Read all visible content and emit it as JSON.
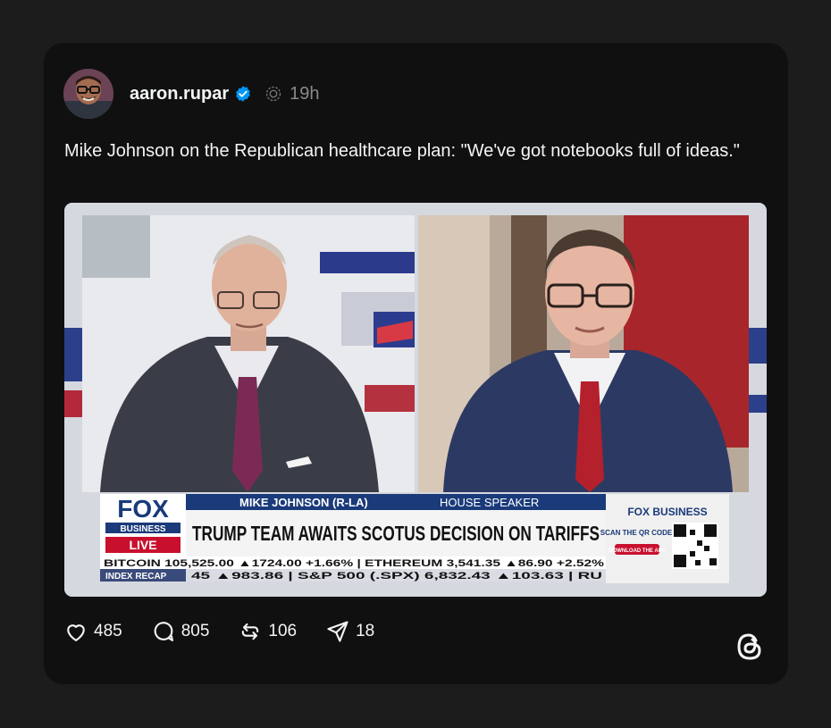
{
  "post": {
    "username": "aaron.rupar",
    "verified": true,
    "timestamp": "19h",
    "text": "Mike Johnson on the Republican healthcare plan: \"We've got notebooks full of ideas.\"",
    "icons": {
      "avatar": "avatar-image",
      "verified": "verified-badge-icon",
      "crosspost": "threads-crosspost-icon"
    }
  },
  "media": {
    "kind": "video-still",
    "network_logo": "FOX",
    "network_sub": "BUSINESS",
    "live_label": "LIVE",
    "nameplate": "MIKE JOHNSON (R-LA)",
    "nameplate_role": "HOUSE SPEAKER",
    "headline": "TRUMP TEAM AWAITS SCOTUS DECISION ON TARIFFS",
    "side_brand": "FOX BUSINESS",
    "side_scan": "SCAN THE QR CODE",
    "side_download": "DOWNLOAD THE APP",
    "ticker_row1": "BITCOIN 105,525.00 ▲1724.00 +1.66% | ETHEREUM 3,541.35 ▲86.90 +2.52%",
    "ticker_row2_label": "INDEX RECAP",
    "ticker_row2": "45 ▲983.86 | S&P 500 (.SPX) 6,832.43 ▲103.63 | RU"
  },
  "actions": {
    "likes": "485",
    "replies": "805",
    "reposts": "106",
    "shares": "18"
  },
  "colors": {
    "card_bg": "#101010",
    "page_bg": "#1c1c1c",
    "verified_blue": "#0095f6",
    "fox_red": "#c8102e",
    "fox_navy": "#1a3a7a"
  }
}
